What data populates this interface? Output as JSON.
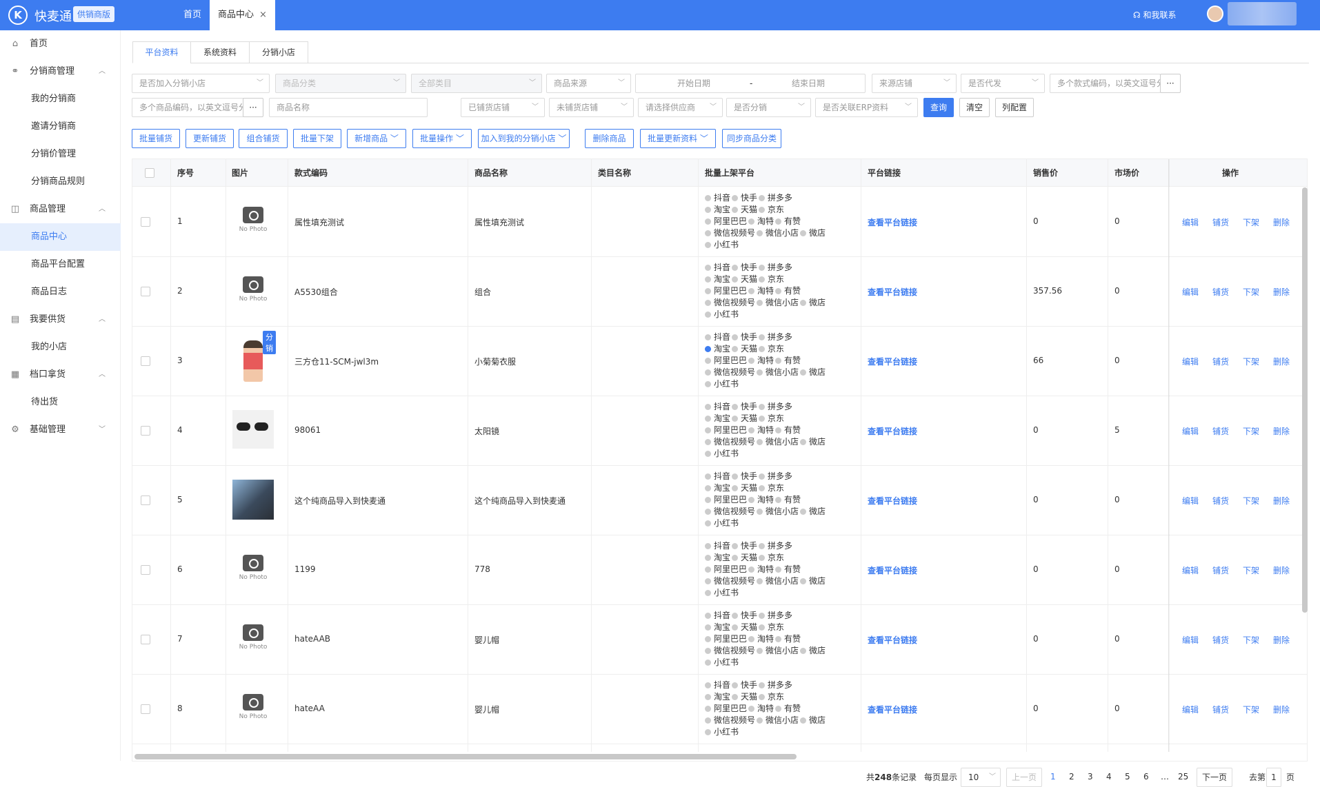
{
  "header": {
    "logo_text": "K",
    "brand": "快麦通",
    "edition": "供销商版",
    "tabs": [
      {
        "label": "首页"
      },
      {
        "label": "商品中心",
        "close": "×"
      }
    ],
    "contact": "和我联系",
    "accent": "#3d7cf0"
  },
  "sidebar": {
    "items": [
      {
        "icon": "home-icon",
        "glyph": "⌂",
        "label": "首页"
      },
      {
        "icon": "distributor-icon",
        "glyph": "⚭",
        "label": "分销商管理",
        "chevron": "︿"
      },
      {
        "label": "我的分销商"
      },
      {
        "label": "邀请分销商"
      },
      {
        "label": "分销价管理"
      },
      {
        "label": "分销商品规则"
      },
      {
        "icon": "bag-icon",
        "glyph": "◫",
        "label": "商品管理",
        "chevron": "︿"
      },
      {
        "label": "商品中心"
      },
      {
        "label": "商品平台配置"
      },
      {
        "label": "商品日志"
      },
      {
        "icon": "store-icon",
        "glyph": "▤",
        "label": "我要供货",
        "chevron": "︿"
      },
      {
        "label": "我的小店"
      },
      {
        "icon": "calendar-icon",
        "glyph": "▦",
        "label": "档口拿货",
        "chevron": "︿"
      },
      {
        "label": "待出货"
      },
      {
        "icon": "gear-icon",
        "glyph": "⚙",
        "label": "基础管理",
        "chevron": "﹀"
      }
    ]
  },
  "subtabs": [
    "平台资料",
    "系统资料",
    "分销小店"
  ],
  "filters": {
    "row1": [
      "是否加入分销小店",
      "商品分类",
      "全部类目",
      "商品来源",
      "开始日期",
      "-",
      "结束日期",
      "来源店铺",
      "是否代发",
      "多个款式编码，以英文逗号分割"
    ],
    "row2": [
      "多个商品编码，以英文逗号分割",
      "商品名称",
      "已铺货店铺",
      "未铺货店铺",
      "请选择供应商",
      "是否分销",
      "是否关联ERP资料"
    ],
    "more": "···",
    "query": "查询",
    "clear": "清空",
    "colconfig": "列配置"
  },
  "actions": [
    "批量铺货",
    "更新铺货",
    "组合铺货",
    "批量下架",
    "新增商品",
    "批量操作",
    "加入到我的分销小店",
    "删除商品",
    "批量更新资料",
    "同步商品分类"
  ],
  "table": {
    "headers": [
      "序号",
      "图片",
      "款式编码",
      "商品名称",
      "类目名称",
      "批量上架平台",
      "平台链接",
      "销售价",
      "市场价",
      "操作"
    ],
    "platforms": [
      [
        "抖音",
        "快手",
        "拼多多"
      ],
      [
        "淘宝",
        "天猫",
        "京东"
      ],
      [
        "阿里巴巴",
        "淘特",
        "有赞"
      ],
      [
        "微信视频号",
        "微信小店",
        "微店"
      ],
      [
        "小红书"
      ]
    ],
    "link_label": "查看平台链接",
    "ops": [
      "编辑",
      "铺货",
      "下架",
      "删除"
    ],
    "no_photo": "No Photo",
    "tag_fx": "分销",
    "rows": [
      {
        "idx": "1",
        "code": "属性填充测试",
        "name": "属性填充测试",
        "price": "0",
        "market": "0",
        "photo": "none",
        "checked": ""
      },
      {
        "idx": "2",
        "code": "A5530组合",
        "name": "组合",
        "price": "357.56",
        "market": "0",
        "photo": "none",
        "checked": ""
      },
      {
        "idx": "3",
        "code": "三方仓11-SCM-jwl3m",
        "name": "小菊菊衣服",
        "price": "66",
        "market": "0",
        "photo": "girl",
        "checked": "淘宝"
      },
      {
        "idx": "4",
        "code": "98061",
        "name": "太阳镜",
        "price": "0",
        "market": "5",
        "photo": "glasses",
        "checked": ""
      },
      {
        "idx": "5",
        "code": "这个纯商品导入到快麦通",
        "name": "这个纯商品导入到快麦通",
        "price": "0",
        "market": "0",
        "photo": "person",
        "checked": ""
      },
      {
        "idx": "6",
        "code": "1199",
        "name": "778",
        "price": "0",
        "market": "0",
        "photo": "none",
        "checked": ""
      },
      {
        "idx": "7",
        "code": "hateAAB",
        "name": "婴儿帽",
        "price": "0",
        "market": "0",
        "photo": "none",
        "checked": ""
      },
      {
        "idx": "8",
        "code": "hateAA",
        "name": "婴儿帽",
        "price": "0",
        "market": "0",
        "photo": "none",
        "checked": ""
      }
    ]
  },
  "pager": {
    "total_prefix": "共",
    "total": "248",
    "total_suffix": "条记录",
    "per_page_label": "每页显示",
    "per_page": "10",
    "prev": "上一页",
    "pages": [
      "1",
      "2",
      "3",
      "4",
      "5",
      "6",
      "…",
      "25"
    ],
    "next": "下一页",
    "goto_label": "去第",
    "goto": "1",
    "goto_suffix": "页"
  }
}
